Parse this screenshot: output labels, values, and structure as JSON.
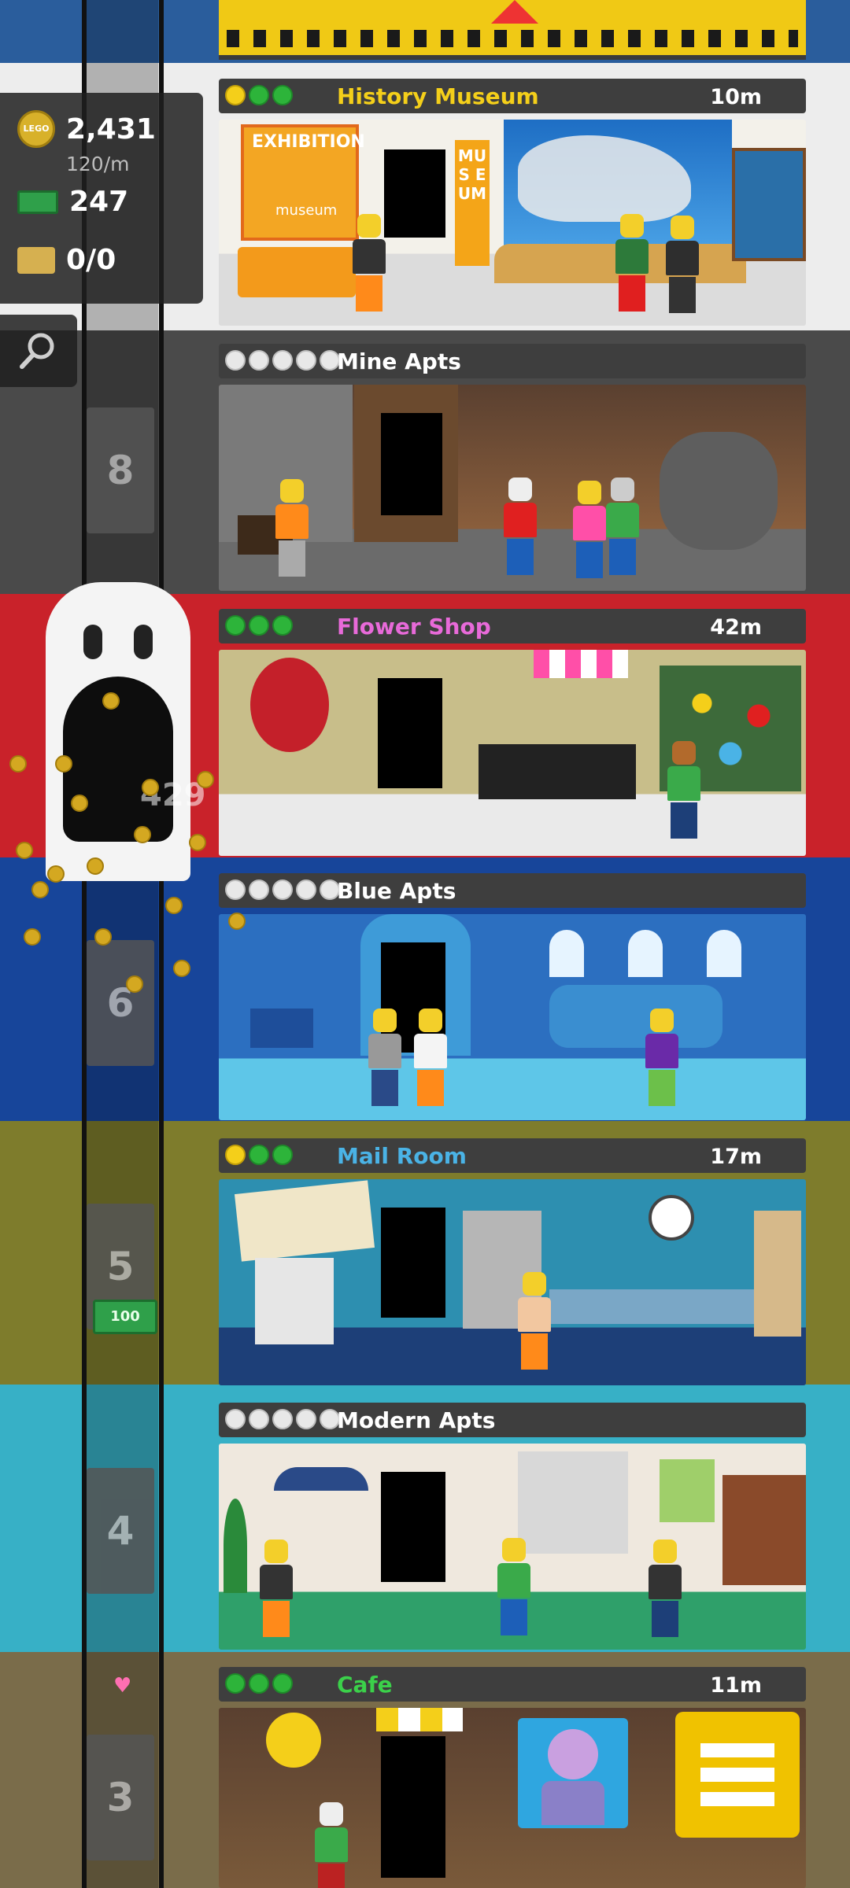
{
  "hud": {
    "coins": "2,431",
    "coin_rate": "120/m",
    "bux": "247",
    "bricks": "0/0",
    "coin_icon_label": "LEGO",
    "icons": [
      "lego-coin-icon",
      "bux-icon",
      "brick-icon",
      "search-icon"
    ]
  },
  "elevator": {
    "floor_labels": [
      "8",
      "6",
      "5",
      "4",
      "3"
    ],
    "ghost_counter": "429",
    "bux_pickup": "100",
    "heart": "♥"
  },
  "floors": [
    {
      "name": "History Museum",
      "time": "10m",
      "rating": "3",
      "name_color": "#f4cf1a"
    },
    {
      "name": "Mine Apts",
      "time": "",
      "rating": "5",
      "name_color": "#ffffff"
    },
    {
      "name": "Flower Shop",
      "time": "42m",
      "rating": "3",
      "name_color": "#e86ad9"
    },
    {
      "name": "Blue Apts",
      "time": "",
      "rating": "5",
      "name_color": "#ffffff"
    },
    {
      "name": "Mail Room",
      "time": "17m",
      "rating": "3",
      "name_color": "#4ab3e6"
    },
    {
      "name": "Modern Apts",
      "time": "",
      "rating": "5",
      "name_color": "#ffffff"
    },
    {
      "name": "Cafe",
      "time": "11m",
      "rating": "3",
      "name_color": "#3bd14a"
    }
  ],
  "museum_sign": {
    "exhibition": "EXHIBITION",
    "museum": "museum",
    "vertical": "MUS EUM"
  },
  "colors": {
    "museum_bg": "#f1efe6",
    "mine_bg": "#6b4a34",
    "flower_bg": "#d4262b",
    "blue_bg": "#1f5fb8",
    "mail_bg": "#8a8a34",
    "modern_bg": "#42b8c8",
    "cafe_bg": "#8a7a5c"
  }
}
